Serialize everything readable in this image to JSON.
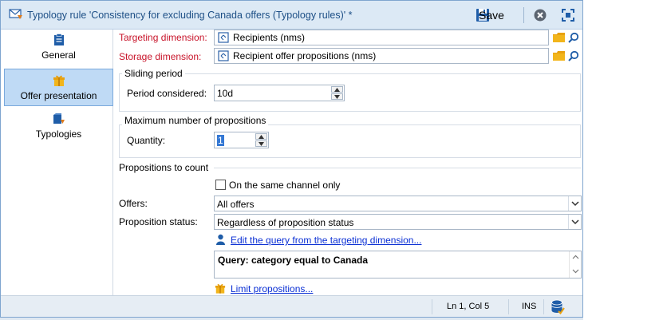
{
  "window": {
    "title": "Typology rule 'Consistency for excluding Canada offers (Typology rules)' *",
    "save_label": "Save",
    "accent_color": "#1d4f86"
  },
  "sidebar": {
    "items": [
      {
        "label": "General",
        "icon": "clipboard-icon",
        "active": false
      },
      {
        "label": "Offer presentation",
        "icon": "gift-icon",
        "active": true
      },
      {
        "label": "Typologies",
        "icon": "typologies-icon",
        "active": false
      }
    ]
  },
  "targeting": {
    "label": "Targeting dimension:",
    "value": "Recipients (nms)"
  },
  "storage": {
    "label": "Storage dimension:",
    "value": "Recipient offer propositions (nms)"
  },
  "sliding_period": {
    "title": "Sliding period",
    "period_label": "Period considered:",
    "period_value": "10d"
  },
  "max_props": {
    "title": "Maximum number of propositions",
    "quantity_label": "Quantity:",
    "quantity_value": "1"
  },
  "propositions": {
    "section_title": "Propositions to count",
    "same_channel_label": "On the same channel only",
    "same_channel_checked": false,
    "offers_label": "Offers:",
    "offers_value": "All offers",
    "status_label": "Proposition status:",
    "status_value": "Regardless of proposition status",
    "edit_query_link": "Edit the query from the targeting dimension...",
    "query_text": "Query: category equal to Canada",
    "limit_link": "Limit propositions..."
  },
  "statusbar": {
    "position": "Ln 1, Col 5",
    "mode": "INS"
  }
}
